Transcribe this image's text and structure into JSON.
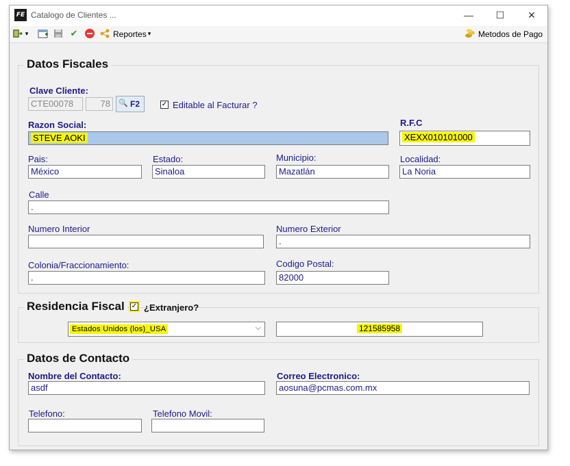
{
  "window": {
    "title": "Catalogo de Clientes ...",
    "logo": "FE",
    "controls": {
      "minimize": "—",
      "maximize": "☐",
      "close": "✕"
    }
  },
  "toolbar": {
    "reports_label": "Reportes",
    "payment_methods_label": "Metodos de Pago"
  },
  "datos_fiscales": {
    "title": "Datos Fiscales",
    "clave_label": "Clave Cliente:",
    "clave_value": "CTE00078",
    "clave_num": "78",
    "f2_label": "F2",
    "editable_label": "Editable al Facturar ?",
    "editable_checked": true,
    "razon_label": "Razon Social:",
    "razon_value": "STEVE AOKI",
    "rfc_label": "R.F.C",
    "rfc_value": "XEXX010101000",
    "pais_label": "Pais:",
    "pais_value": "México",
    "estado_label": "Estado:",
    "estado_value": "Sinaloa",
    "municipio_label": "Municipio:",
    "municipio_value": "Mazatlán",
    "localidad_label": "Localidad:",
    "localidad_value": "La Noria",
    "calle_label": "Calle",
    "calle_value": ".",
    "num_int_label": "Numero Interior",
    "num_int_value": "",
    "num_ext_label": "Numero Exterior",
    "num_ext_value": ".",
    "colonia_label": "Colonia/Fraccionamiento:",
    "colonia_value": ".",
    "cp_label": "Codigo Postal:",
    "cp_value": "82000"
  },
  "residencia": {
    "title": "Residencia Fiscal",
    "extranjero_label": "¿Extranjero?",
    "extranjero_checked": true,
    "pais_selected": "Estados Unidos (los)_USA",
    "tax_id": "121585958"
  },
  "contacto": {
    "title": "Datos de Contacto",
    "nombre_label": "Nombre del Contacto:",
    "nombre_value": "asdf",
    "correo_label": "Correo Electronico:",
    "correo_value": "aosuna@pcmas.com.mx",
    "telefono_label": "Telefono:",
    "telefono_value": "",
    "movil_label": "Telefono Movil:",
    "movil_value": ""
  },
  "colors": {
    "label_blue": "#1a1a8c",
    "highlight": "#f6f600",
    "selection": "#a9c8ea"
  }
}
